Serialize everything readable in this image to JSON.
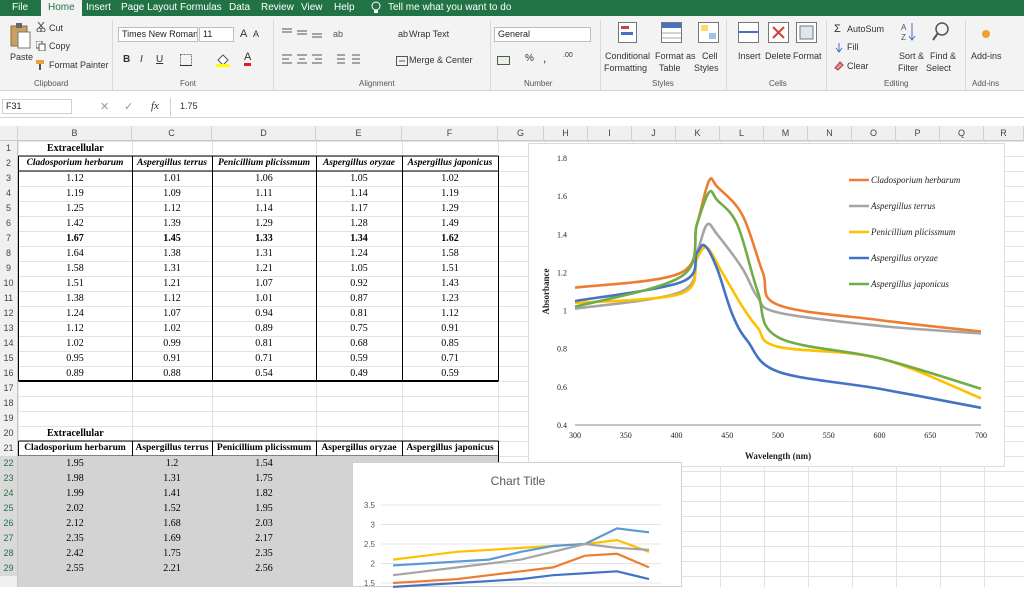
{
  "ribbon_tabs": [
    "File",
    "Home",
    "Insert",
    "Page Layout",
    "Formulas",
    "Data",
    "Review",
    "View",
    "Help"
  ],
  "active_tab": "Home",
  "tell_me": "Tell me what you want to do",
  "clipboard": {
    "paste": "Paste",
    "cut": "Cut",
    "copy": "Copy",
    "format_painter": "Format Painter",
    "label": "Clipboard"
  },
  "font": {
    "name": "Times New Roman",
    "size": "11",
    "grow": "A",
    "shrink": "A",
    "bold": "B",
    "italic": "I",
    "underline": "U",
    "font_color_letter": "A",
    "label": "Font"
  },
  "alignment": {
    "wrap": "Wrap Text",
    "merge": "Merge & Center",
    "label": "Alignment"
  },
  "number": {
    "format": "General",
    "percent": "%",
    "comma": ",",
    "inc_dec": ".00",
    "label": "Number"
  },
  "styles": {
    "conditional": "Conditional",
    "conditional2": "Formatting",
    "format_as": "Format as",
    "format_as2": "Table",
    "cell_styles": "Cell",
    "cell_styles2": "Styles",
    "label": "Styles"
  },
  "cells": {
    "insert": "Insert",
    "delete": "Delete",
    "format": "Format",
    "label": "Cells"
  },
  "editing": {
    "autosum": "AutoSum",
    "fill": "Fill",
    "clear": "Clear",
    "sort": "Sort &",
    "sort2": "Filter",
    "find": "Find &",
    "find2": "Select",
    "label": "Editing"
  },
  "addins": {
    "label1": "Add-ins",
    "label2": "Add-ins"
  },
  "formula_bar": {
    "name_box": "F31",
    "fx": "fx",
    "value": "1.75"
  },
  "columns": [
    "B",
    "C",
    "D",
    "E",
    "F",
    "G",
    "H",
    "I",
    "J",
    "K",
    "L",
    "M",
    "N",
    "O",
    "P",
    "Q",
    "R"
  ],
  "rows": [
    "1",
    "2",
    "3",
    "4",
    "5",
    "6",
    "7",
    "8",
    "9",
    "10",
    "11",
    "12",
    "13",
    "14",
    "15",
    "16",
    "17",
    "18",
    "19",
    "20",
    "21",
    "22",
    "23",
    "24",
    "25",
    "26",
    "27",
    "28",
    "29"
  ],
  "table1": {
    "title": "Extracellular",
    "headers": [
      "Cladosporium herbarum",
      "Aspergillus terrus",
      "Penicillium plicissmum",
      "Aspergillus oryzae",
      "Aspergillus japonicus"
    ],
    "rows": [
      [
        "1.12",
        "1.01",
        "1.06",
        "1.05",
        "1.02"
      ],
      [
        "1.19",
        "1.09",
        "1.11",
        "1.14",
        "1.19"
      ],
      [
        "1.25",
        "1.12",
        "1.14",
        "1.17",
        "1.29"
      ],
      [
        "1.42",
        "1.39",
        "1.29",
        "1.28",
        "1.49"
      ],
      [
        "1.67",
        "1.45",
        "1.33",
        "1.34",
        "1.62"
      ],
      [
        "1.64",
        "1.38",
        "1.31",
        "1.24",
        "1.58"
      ],
      [
        "1.58",
        "1.31",
        "1.21",
        "1.05",
        "1.51"
      ],
      [
        "1.51",
        "1.21",
        "1.07",
        "0.92",
        "1.43"
      ],
      [
        "1.38",
        "1.12",
        "1.01",
        "0.87",
        "1.23"
      ],
      [
        "1.24",
        "1.07",
        "0.94",
        "0.81",
        "1.12"
      ],
      [
        "1.12",
        "1.02",
        "0.89",
        "0.75",
        "0.91"
      ],
      [
        "1.02",
        "0.99",
        "0.81",
        "0.68",
        "0.85"
      ],
      [
        "0.95",
        "0.91",
        "0.71",
        "0.59",
        "0.71"
      ],
      [
        "0.89",
        "0.88",
        "0.54",
        "0.49",
        "0.59"
      ]
    ]
  },
  "table2": {
    "title": "Extracellular",
    "headers": [
      "Cladosporium herbarum",
      "Aspergillus terrus",
      "Penicillium plicissmum",
      "Aspergillus oryzae",
      "Aspergillus japonicus"
    ],
    "rows": [
      [
        "1.95",
        "1.2",
        "1.54"
      ],
      [
        "1.98",
        "1.31",
        "1.75"
      ],
      [
        "1.99",
        "1.41",
        "1.82"
      ],
      [
        "2.02",
        "1.52",
        "1.95"
      ],
      [
        "2.12",
        "1.68",
        "2.03"
      ],
      [
        "2.35",
        "1.69",
        "2.17"
      ],
      [
        "2.42",
        "1.75",
        "2.35"
      ],
      [
        "2.55",
        "2.21",
        "2.56"
      ]
    ]
  },
  "colors": {
    "excel_green": "#217346",
    "orange": "#ED7D31",
    "gray": "#A5A5A5",
    "yellow": "#FFC000",
    "blue": "#4472C4",
    "green": "#70AD47",
    "selected_fill": "#d3d3d3"
  },
  "chart_data": [
    {
      "type": "line",
      "title": "",
      "xlabel": "Wavelength (nm)",
      "ylabel": "Absorbance",
      "xlim": [
        300,
        700
      ],
      "ylim": [
        0.4,
        1.8
      ],
      "x_ticks": [
        "300",
        "350",
        "400",
        "450",
        "500",
        "550",
        "600",
        "650",
        "700"
      ],
      "y_ticks": [
        "0.4",
        "0.6",
        "0.8",
        "1",
        "1.2",
        "1.4",
        "1.6",
        "1.8"
      ],
      "legend_position": "right",
      "grid": false,
      "series": [
        {
          "name": "Cladosporium herbarum",
          "color": "#ED7D31",
          "points": [
            [
              300,
              1.12
            ],
            [
              405,
              1.2
            ],
            [
              420,
              1.45
            ],
            [
              432,
              1.68
            ],
            [
              440,
              1.65
            ],
            [
              465,
              1.5
            ],
            [
              485,
              1.2
            ],
            [
              500,
              1.03
            ],
            [
              600,
              0.95
            ],
            [
              700,
              0.89
            ]
          ]
        },
        {
          "name": "Aspergillus terrus",
          "color": "#A5A5A5",
          "points": [
            [
              300,
              1.01
            ],
            [
              405,
              1.1
            ],
            [
              420,
              1.3
            ],
            [
              430,
              1.45
            ],
            [
              440,
              1.4
            ],
            [
              465,
              1.22
            ],
            [
              480,
              1.07
            ],
            [
              500,
              0.99
            ],
            [
              600,
              0.92
            ],
            [
              700,
              0.88
            ]
          ]
        },
        {
          "name": "Penicillium plicissmum",
          "color": "#FFC000",
          "points": [
            [
              300,
              1.04
            ],
            [
              405,
              1.09
            ],
            [
              420,
              1.27
            ],
            [
              430,
              1.33
            ],
            [
              445,
              1.2
            ],
            [
              465,
              1.02
            ],
            [
              480,
              0.91
            ],
            [
              500,
              0.81
            ],
            [
              600,
              0.75
            ],
            [
              700,
              0.54
            ]
          ]
        },
        {
          "name": "Aspergillus oryzae",
          "color": "#4472C4",
          "points": [
            [
              300,
              1.05
            ],
            [
              405,
              1.15
            ],
            [
              420,
              1.3
            ],
            [
              428,
              1.34
            ],
            [
              440,
              1.22
            ],
            [
              455,
              0.98
            ],
            [
              470,
              0.84
            ],
            [
              500,
              0.68
            ],
            [
              600,
              0.59
            ],
            [
              700,
              0.49
            ]
          ]
        },
        {
          "name": "Aspergillus japonicus",
          "color": "#70AD47",
          "points": [
            [
              300,
              1.02
            ],
            [
              405,
              1.18
            ],
            [
              420,
              1.45
            ],
            [
              432,
              1.62
            ],
            [
              440,
              1.58
            ],
            [
              460,
              1.45
            ],
            [
              480,
              1.1
            ],
            [
              500,
              0.86
            ],
            [
              600,
              0.75
            ],
            [
              700,
              0.59
            ]
          ]
        }
      ]
    },
    {
      "type": "line",
      "title": "Chart Title",
      "ylim": [
        1.5,
        3.5
      ],
      "y_ticks": [
        "3.5",
        "3",
        "2.5",
        "2",
        "1.5"
      ],
      "series": [
        {
          "color": "#FFC000",
          "values": [
            2.1,
            2.2,
            2.3,
            2.35,
            2.4,
            2.45,
            2.5,
            2.6,
            2.3
          ]
        },
        {
          "color": "#5B9BD5",
          "values": [
            1.95,
            2.0,
            2.05,
            2.1,
            2.3,
            2.45,
            2.5,
            2.9,
            2.8
          ]
        },
        {
          "color": "#A5A5A5",
          "values": [
            1.7,
            1.8,
            1.9,
            2.0,
            2.1,
            2.3,
            2.5,
            2.4,
            2.35
          ]
        },
        {
          "color": "#ED7D31",
          "values": [
            1.5,
            1.55,
            1.6,
            1.7,
            1.8,
            1.9,
            2.2,
            2.25,
            1.9
          ]
        },
        {
          "color": "#4472C4",
          "values": [
            1.4,
            1.45,
            1.5,
            1.55,
            1.6,
            1.7,
            1.75,
            1.8,
            1.6
          ]
        }
      ]
    }
  ]
}
